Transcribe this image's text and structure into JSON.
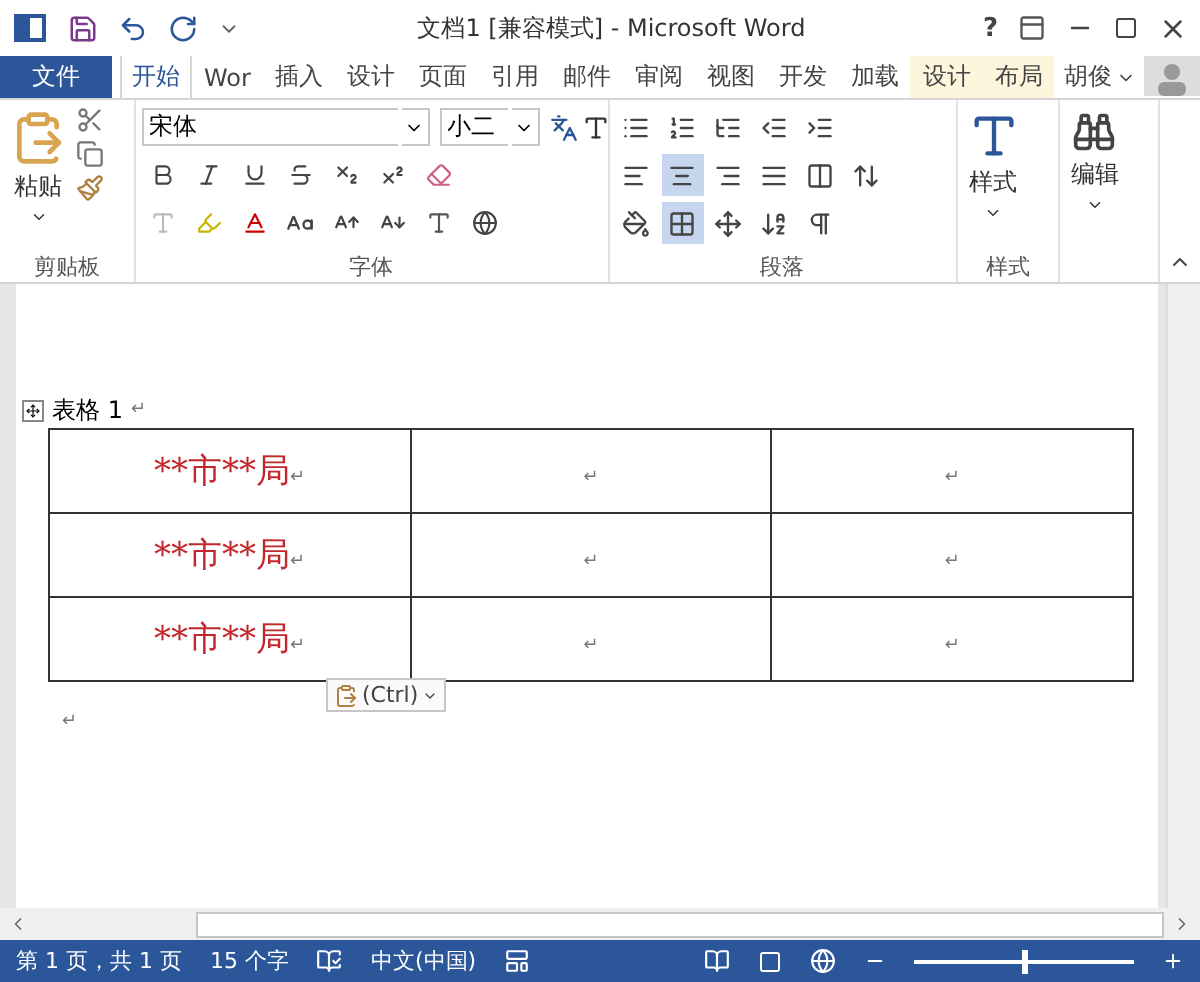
{
  "window": {
    "title": "文档1 [兼容模式] - Microsoft Word",
    "help": "?"
  },
  "tabs": [
    {
      "label": "文件",
      "kind": "file",
      "selected": false
    },
    {
      "label": "开始",
      "kind": "tab",
      "selected": true
    },
    {
      "label": "Wor",
      "kind": "tab",
      "selected": false
    },
    {
      "label": "插入",
      "kind": "tab",
      "selected": false
    },
    {
      "label": "设计",
      "kind": "tab",
      "selected": false
    },
    {
      "label": "页面",
      "kind": "tab",
      "selected": false
    },
    {
      "label": "引用",
      "kind": "tab",
      "selected": false
    },
    {
      "label": "邮件",
      "kind": "tab",
      "selected": false
    },
    {
      "label": "审阅",
      "kind": "tab",
      "selected": false
    },
    {
      "label": "视图",
      "kind": "tab",
      "selected": false
    },
    {
      "label": "开发",
      "kind": "tab",
      "selected": false
    },
    {
      "label": "加载",
      "kind": "tab",
      "selected": false
    },
    {
      "label": "设计",
      "kind": "context",
      "selected": false
    },
    {
      "label": "布局",
      "kind": "context",
      "selected": false
    }
  ],
  "user": {
    "name": "胡俊"
  },
  "ribbon": {
    "clipboard": {
      "paste": "粘贴",
      "label": "剪贴板"
    },
    "font": {
      "name": "宋体",
      "size": "小二",
      "label": "字体"
    },
    "paragraph": {
      "label": "段落",
      "align_buttons": [
        {
          "kind": "left",
          "selected": false
        },
        {
          "kind": "center",
          "selected": true
        },
        {
          "kind": "right",
          "selected": false
        },
        {
          "kind": "justify",
          "selected": false
        }
      ],
      "borders_selected": true
    },
    "styles": {
      "button": "样式",
      "label": "样式"
    },
    "editing": {
      "button": "编辑"
    }
  },
  "document": {
    "caption": {
      "text": "表格 1",
      "mark": "↵"
    },
    "table": {
      "rows": [
        [
          {
            "text": "**市**局",
            "mark": "↵"
          },
          {
            "mark": "↵"
          },
          {
            "mark": "↵"
          }
        ],
        [
          {
            "text": "**市**局",
            "mark": "↵"
          },
          {
            "mark": "↵"
          },
          {
            "mark": "↵"
          }
        ],
        [
          {
            "text": "**市**局",
            "mark": "↵"
          },
          {
            "mark": "↵"
          },
          {
            "mark": "↵"
          }
        ]
      ]
    },
    "paste_options": "(Ctrl)",
    "end_mark": "↵"
  },
  "status_bar": {
    "page": "第 1 页，共 1 页",
    "words": "15 个字",
    "language": "中文(中国)",
    "zoom": {
      "level": 0.5
    }
  }
}
